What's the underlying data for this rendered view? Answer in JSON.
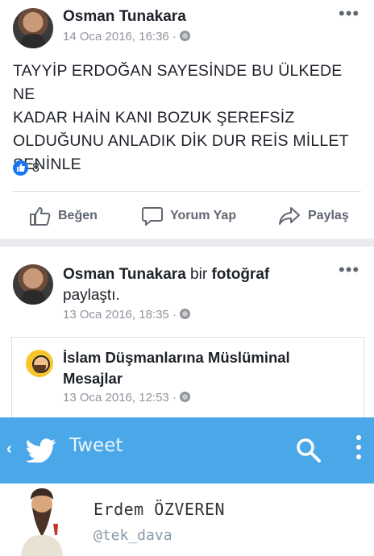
{
  "post1": {
    "author": "Osman Tunakara",
    "timestamp": "14 Oca 2016, 16:36 · ",
    "privacy_icon": "globe-icon",
    "text_lines": [
      "TAYYİP ERDOĞAN SAYESİNDE BU ÜLKEDE NE",
      "KADAR HAİN KANI BOZUK ŞEREFSİZ",
      "OLDUĞUNU ANLADIK DİK DUR REİS MİLLET",
      "SENİNLE"
    ],
    "reaction_count": "8",
    "actions": {
      "like": "Beğen",
      "comment": "Yorum Yap",
      "share": "Paylaş"
    }
  },
  "post2": {
    "author": "Osman Tunakara",
    "verb_pre": " bir ",
    "verb_link": "fotoğraf",
    "verb_post": "paylaştı.",
    "timestamp": "13 Oca 2016, 18:35 · "
  },
  "shared": {
    "page_name_line1": "İslam Düşmanlarına Müslüminal",
    "page_name_line2": "Mesajlar",
    "timestamp": "13 Oca 2016, 12:53 · "
  },
  "tweet": {
    "title": "Tweet",
    "author_name": "Erdem ÖZVEREN",
    "author_handle": "@tek_dava"
  },
  "colors": {
    "facebook_blue": "#1877f2",
    "twitter_bar": "#4aa8e8"
  }
}
